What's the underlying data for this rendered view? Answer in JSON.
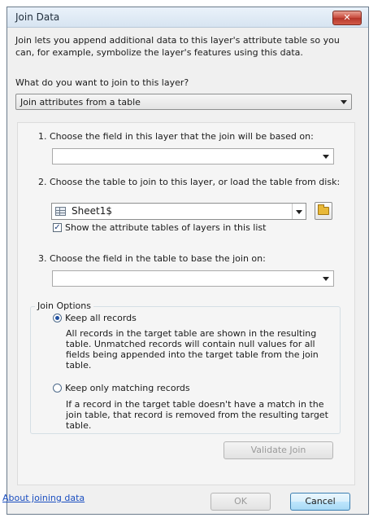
{
  "window": {
    "title": "Join Data",
    "close_glyph": "✕"
  },
  "intro": {
    "description": "Join lets you append additional data to this layer's attribute table so you can, for example, symbolize the layer's features using this data.",
    "question": "What do you want to join to this layer?",
    "join_type_value": "Join attributes from a table"
  },
  "step1": {
    "label": "1.  Choose the field in this layer that the join will be based on:",
    "value": ""
  },
  "step2": {
    "label": "2.  Choose the table to join to this layer, or load the table from disk:",
    "table_value": "Sheet1$",
    "table_icon": "table-icon",
    "browse_icon": "folder-open-icon",
    "show_layers_checked": true,
    "show_layers_label": "Show the attribute tables of layers in this list"
  },
  "step3": {
    "label": "3.  Choose the field in the table to base the join on:",
    "value": ""
  },
  "join_options": {
    "title": "Join Options",
    "keep_all": {
      "selected": true,
      "label": "Keep all records",
      "description": "All records in the target table are shown in the resulting table. Unmatched records will contain null values for all fields being appended into the target table from the join table."
    },
    "keep_matching": {
      "selected": false,
      "label": "Keep only matching records",
      "description": "If a record in the target table doesn't have a match in the join table, that record is removed from the resulting target table."
    }
  },
  "buttons": {
    "validate": "Validate Join",
    "ok": "OK",
    "cancel": "Cancel"
  },
  "links": {
    "about": "About joining data"
  }
}
